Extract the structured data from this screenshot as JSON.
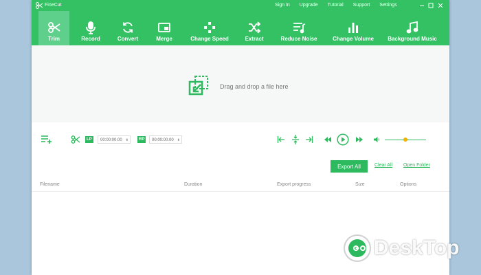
{
  "titlebar": {
    "app_name": "FineCut",
    "menu": [
      "Sign In",
      "Upgrade",
      "Tutorial",
      "Support",
      "Settings"
    ]
  },
  "toolbar": {
    "tools": [
      {
        "label": "Trim",
        "icon": "scissors-icon",
        "active": true
      },
      {
        "label": "Record",
        "icon": "microphone-icon",
        "active": false
      },
      {
        "label": "Convert",
        "icon": "refresh-icon",
        "active": false
      },
      {
        "label": "Merge",
        "icon": "merge-icon",
        "active": false
      },
      {
        "label": "Change Speed",
        "icon": "speed-icon",
        "active": false
      },
      {
        "label": "Extract",
        "icon": "shuffle-icon",
        "active": false
      },
      {
        "label": "Reduce Noise",
        "icon": "noise-icon",
        "active": false
      },
      {
        "label": "Change Volume",
        "icon": "bars-icon",
        "active": false
      },
      {
        "label": "Background Music",
        "icon": "music-note-icon",
        "active": false
      }
    ]
  },
  "dropzone": {
    "text": "Drag and drop a file here"
  },
  "controls": {
    "lp_label": "LP",
    "lp_time": "00:00:00.00",
    "rp_label": "RP",
    "rp_time": "00:00:00.00",
    "volume_level": 0.5
  },
  "actions": {
    "export_all": "Export All",
    "clear_all": "Clear All",
    "open_folder": "Open Folder"
  },
  "table": {
    "columns": [
      "Filename",
      "Duration",
      "Export progress",
      "Size",
      "Options"
    ]
  },
  "watermark": {
    "text": "DeskTop"
  },
  "colors": {
    "brand": "#33c163",
    "accent": "#2db95e",
    "slider_thumb": "#f0b400"
  }
}
